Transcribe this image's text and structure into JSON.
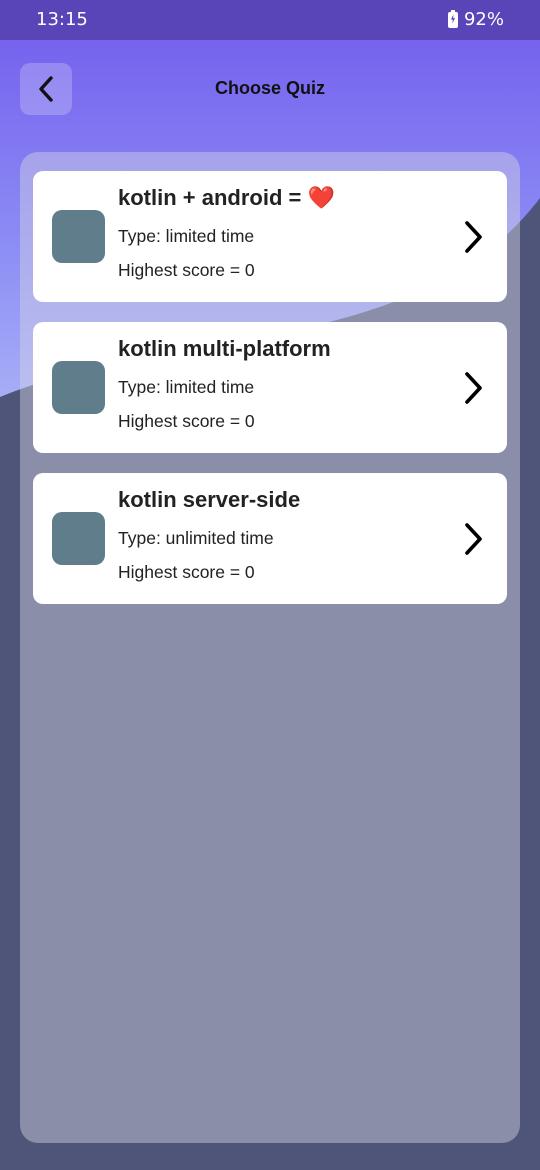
{
  "status_bar": {
    "time": "13:15",
    "battery": "92%",
    "icons": [
      "battery-charging-icon"
    ]
  },
  "header": {
    "title": "Choose Quiz",
    "back_icon": "chevron-left-icon"
  },
  "quizzes": [
    {
      "title": "kotlin + android = ❤️",
      "type": "Type: limited time",
      "score": "Highest score = 0"
    },
    {
      "title": "kotlin multi-platform",
      "type": "Type: limited time",
      "score": "Highest score = 0"
    },
    {
      "title": "kotlin server-side",
      "type": "Type: unlimited time",
      "score": "Highest score = 0"
    }
  ],
  "colors": {
    "status_bar": "#5a45b8",
    "gradient_top": "#7c6af2",
    "gradient_bottom": "#a5a8f5",
    "background_dark": "#4f5479",
    "thumbnail": "#607d8b",
    "heart": "#e84a4a"
  }
}
